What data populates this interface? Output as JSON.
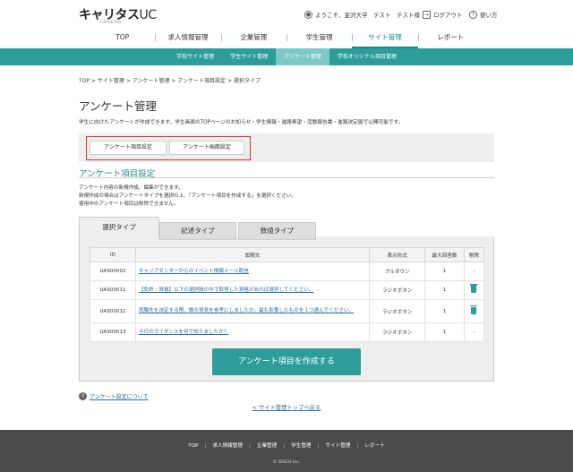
{
  "header": {
    "logo_main": "キャリタス",
    "logo_uc": "UC",
    "logo_sub": "CAREETAS",
    "welcome": "ようこそ、金沢大学　テスト　テスト様",
    "logout": "ログアウト",
    "help": "使い方",
    "icons": {
      "user": "user-icon",
      "logout": "logout-icon",
      "help": "help-icon"
    }
  },
  "main_nav": [
    {
      "label": "TOP"
    },
    {
      "label": "求人情報管理"
    },
    {
      "label": "企業管理"
    },
    {
      "label": "学生管理"
    },
    {
      "label": "サイト管理",
      "active": true
    },
    {
      "label": "レポート"
    }
  ],
  "sub_nav": [
    {
      "label": "学校サイト管理"
    },
    {
      "label": "学生サイト管理"
    },
    {
      "label": "アンケート管理",
      "active": true
    },
    {
      "label": "学校オリジナル項目管理"
    }
  ],
  "breadcrumb": "TOP > サイト管理 > アンケート管理 > アンケート項目設定 > 選択タイプ",
  "page": {
    "title": "アンケート管理",
    "description": "学生に向けたアンケートが作成できます。学生画面のTOPページのお知らせ・学生情報・進路希望・活動報告書・進路決定届で公開可能です。"
  },
  "settings_buttons": {
    "item_settings": "アンケート項目設定",
    "screen_settings": "アンケート画面設定"
  },
  "section": {
    "title": "アンケート項目設定",
    "desc_lines": [
      "アンケート内容の新規作成、編集ができます。",
      "新規作成の場合はアンケートタイプを選択の上、「アンケート項目を作成する」を選択ください。",
      "使用中のアンケート項目は削除できません。"
    ]
  },
  "tabs": [
    {
      "label": "選択タイプ",
      "active": true
    },
    {
      "label": "記述タイプ"
    },
    {
      "label": "数値タイプ"
    }
  ],
  "table": {
    "headers": {
      "id": "ID",
      "question": "設問文",
      "format": "表示形式",
      "max": "最大回答数",
      "delete": "削除"
    },
    "rows": [
      {
        "id": "UAS00002",
        "question": "キャリアセンターからのイベント情報メール配信",
        "format": "プルダウン",
        "max": "1",
        "delete": "-"
      },
      {
        "id": "UAS00011",
        "question": "【免許・資格】以下の選択肢の中で取得した資格があれば選択してください。",
        "format": "ラジオボタン",
        "max": "1",
        "delete_icon": "trash-icon"
      },
      {
        "id": "UAS00012",
        "question": "就職先を決定する際、誰の意見を参考にしましたか。最も影響したものを１つ選んでください。",
        "format": "ラジオボタン",
        "max": "1",
        "delete_icon": "trash-icon"
      },
      {
        "id": "UAS00013",
        "question": "今日のガイダンスを何で知りましたか？",
        "format": "ラジオボタン",
        "max": "1",
        "delete": "-"
      }
    ]
  },
  "create_button": "アンケート項目を作成する",
  "help_link": {
    "mark": "?",
    "label": "アンケート設定について"
  },
  "back_link": "< サイト管理トップへ戻る",
  "footer": {
    "nav": [
      "TOP",
      "求人情報管理",
      "企業管理",
      "学生管理",
      "サイト管理",
      "レポート"
    ],
    "separator": "|",
    "copyright": "© DISCO Inc."
  },
  "colors": {
    "accent": "#2d9d9b",
    "highlight_border": "#d9342b",
    "footer": "#4b4b4b",
    "link": "#2a6f9e"
  }
}
